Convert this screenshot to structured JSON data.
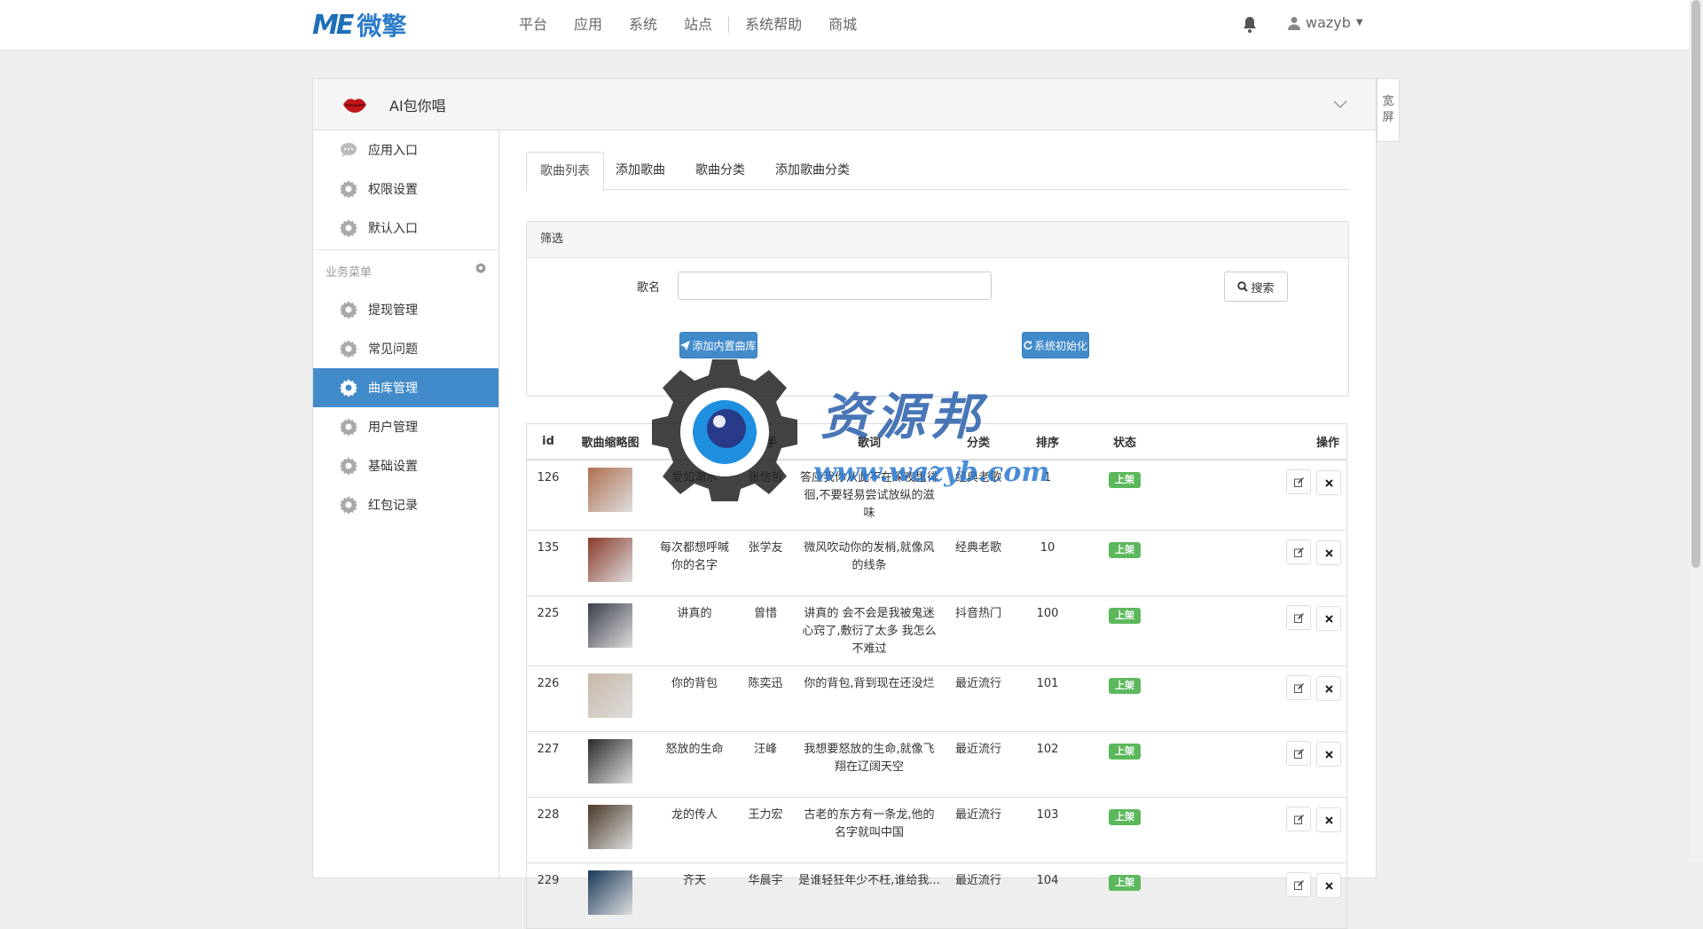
{
  "topbar": {
    "logo_mark": "ME",
    "logo_text": "微擎",
    "nav": [
      "平台",
      "应用",
      "系统",
      "站点",
      "系统帮助",
      "商城"
    ],
    "username": "wazyb"
  },
  "panel": {
    "app_title": "AI包你唱",
    "side_toggle": [
      "宽",
      "屏"
    ]
  },
  "sidebar": {
    "top_items": [
      {
        "label": "应用入口",
        "icon": "chat-icon"
      },
      {
        "label": "权限设置",
        "icon": "gear-icon"
      },
      {
        "label": "默认入口",
        "icon": "gear-icon"
      }
    ],
    "group_title": "业务菜单",
    "items": [
      {
        "label": "提现管理",
        "icon": "gear-icon"
      },
      {
        "label": "常见问题",
        "icon": "gear-icon"
      },
      {
        "label": "曲库管理",
        "icon": "gear-icon",
        "active": true
      },
      {
        "label": "用户管理",
        "icon": "gear-icon"
      },
      {
        "label": "基础设置",
        "icon": "gear-icon"
      },
      {
        "label": "红包记录",
        "icon": "gear-icon"
      }
    ]
  },
  "tabs": [
    "歌曲列表",
    "添加歌曲",
    "歌曲分类",
    "添加歌曲分类"
  ],
  "filter": {
    "title": "筛选",
    "name_label": "歌名",
    "name_value": "",
    "search_label": "搜索",
    "add_builtin_label": "添加内置曲库",
    "init_label": "系统初始化"
  },
  "table": {
    "headers": [
      "id",
      "歌曲缩略图",
      "歌名",
      "歌手",
      "歌词",
      "分类",
      "排序",
      "状态",
      "操作"
    ],
    "status_label": "上架",
    "rows": [
      {
        "id": "126",
        "name": "爱如潮水",
        "singer": "张信哲",
        "lyric": "答应我你从此不在深夜里徘徊,不要轻易尝试放纵的滋味",
        "category": "经典老歌",
        "sort": "1",
        "thumb_color": "#b07050"
      },
      {
        "id": "135",
        "name": "每次都想呼喊你的名字",
        "singer": "张学友",
        "lyric": "微风吹动你的发梢,就像风的线条",
        "category": "经典老歌",
        "sort": "10",
        "thumb_color": "#8a3a2a"
      },
      {
        "id": "225",
        "name": "讲真的",
        "singer": "曾惜",
        "lyric": "讲真的 会不会是我被鬼迷心窍了,敷衍了太多 我怎么不难过",
        "category": "抖音热门",
        "sort": "100",
        "thumb_color": "#3a3f4a"
      },
      {
        "id": "226",
        "name": "你的背包",
        "singer": "陈奕迅",
        "lyric": "你的背包,背到现在还没烂",
        "category": "最近流行",
        "sort": "101",
        "thumb_color": "#c8b8a8"
      },
      {
        "id": "227",
        "name": "怒放的生命",
        "singer": "汪峰",
        "lyric": "我想要怒放的生命,就像飞翔在辽阔天空",
        "category": "最近流行",
        "sort": "102",
        "thumb_color": "#2a2a2a"
      },
      {
        "id": "228",
        "name": "龙的传人",
        "singer": "王力宏",
        "lyric": "古老的东方有一条龙,他的名字就叫中国",
        "category": "最近流行",
        "sort": "103",
        "thumb_color": "#4a3a2a"
      },
      {
        "id": "229",
        "name": "齐天",
        "singer": "华晨宇",
        "lyric": "是谁轻狂年少不枉,谁给我...",
        "category": "最近流行",
        "sort": "104",
        "thumb_color": "#1a3a5a"
      }
    ]
  },
  "watermark": {
    "title": "资源邦",
    "url": "www.wazyb.com"
  },
  "colors": {
    "primary": "#428bca",
    "success": "#5cb85c",
    "logo": "#1e6fb8"
  }
}
